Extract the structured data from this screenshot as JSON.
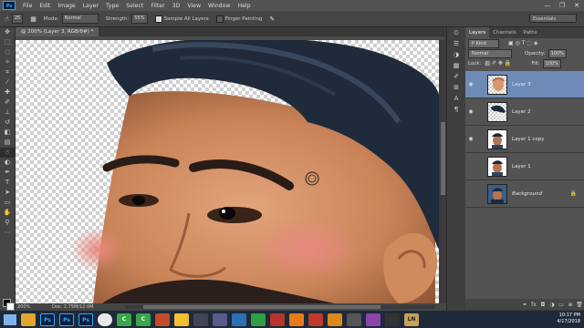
{
  "app": {
    "logo": "Ps"
  },
  "menu": [
    "File",
    "Edit",
    "Image",
    "Layer",
    "Type",
    "Select",
    "Filter",
    "3D",
    "View",
    "Window",
    "Help"
  ],
  "window_controls": {
    "minimize": "—",
    "restore": "❐",
    "close": "✕"
  },
  "options": {
    "brush_size": "25",
    "mode_label": "Mode:",
    "mode_value": "Normal",
    "strength_label": "Strength:",
    "strength_value": "55%",
    "sample_label": "Sample All Layers",
    "finger_label": "Finger Painting",
    "workspace": "Essentials"
  },
  "document": {
    "tab_title": "@ 200% (Layer 3, RGB/8#) *",
    "zoom": "200%",
    "doc_info": "Doc: 2.75M/12.0M"
  },
  "panel": {
    "tabs": [
      "Layers",
      "Channels",
      "Paths"
    ],
    "active_tab": "Layers",
    "kind_label": "P Kind",
    "blend_mode": "Normal",
    "opacity_label": "Opacity:",
    "opacity_value": "100%",
    "lock_label": "Lock:",
    "fill_label": "Fill:",
    "fill_value": "100%"
  },
  "layers": [
    {
      "name": "Layer 3",
      "visible": true,
      "active": true
    },
    {
      "name": "Layer 2",
      "visible": true,
      "active": false
    },
    {
      "name": "Layer 1 copy",
      "visible": true,
      "active": false
    },
    {
      "name": "Layer 1",
      "visible": false,
      "active": false
    },
    {
      "name": "Background",
      "visible": false,
      "active": false,
      "locked": true
    }
  ],
  "taskbar": {
    "apps": [
      "Ps",
      "Ps",
      "Ps",
      "C",
      "C"
    ],
    "time": "10:17 PM",
    "date": "4/17/2018",
    "lang": "LN"
  },
  "colors": {
    "ps_blue": "#31a8ff",
    "layer_highlight": "#6e8bb8",
    "skin": "#d9966e",
    "hair": "#1f2a3a"
  }
}
